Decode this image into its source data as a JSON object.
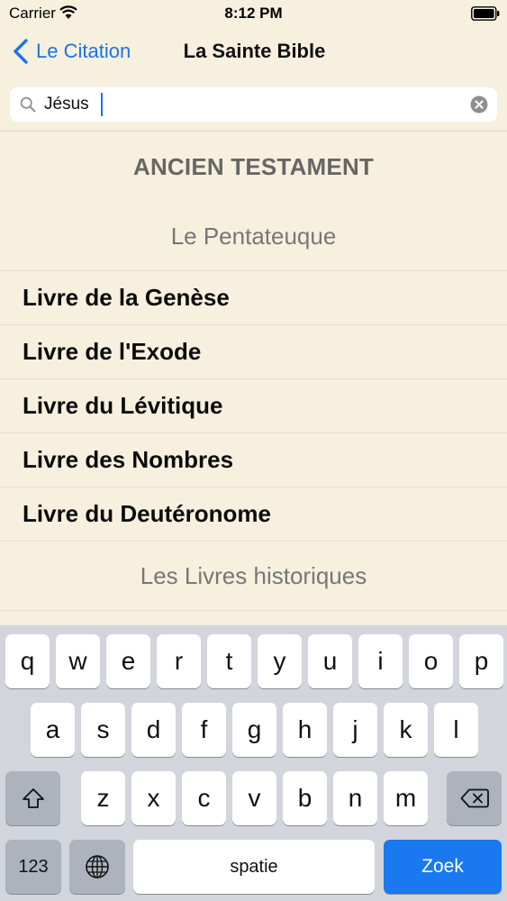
{
  "status_bar": {
    "carrier": "Carrier",
    "time": "8:12 PM"
  },
  "nav": {
    "back_label": "Le Citation",
    "title": "La Sainte Bible"
  },
  "search": {
    "value": "Jésus",
    "placeholder": ""
  },
  "list": {
    "section_title": "ANCIEN TESTAMENT",
    "groups": [
      {
        "title": "Le Pentateuque"
      },
      {
        "title": "Les Livres historiques"
      }
    ],
    "items": [
      "Livre de la Genèse",
      "Livre de l'Exode",
      "Livre du Lévitique",
      "Livre des Nombres",
      "Livre du Deutéronome"
    ]
  },
  "keyboard": {
    "row1": [
      "q",
      "w",
      "e",
      "r",
      "t",
      "y",
      "u",
      "i",
      "o",
      "p"
    ],
    "row2": [
      "a",
      "s",
      "d",
      "f",
      "g",
      "h",
      "j",
      "k",
      "l"
    ],
    "row3": [
      "z",
      "x",
      "c",
      "v",
      "b",
      "n",
      "m"
    ],
    "numbers_label": "123",
    "space_label": "spatie",
    "return_label": "Zoek"
  },
  "colors": {
    "accent": "#1a74e8",
    "background": "#f7f0df",
    "keyboard": "#d2d5db"
  }
}
